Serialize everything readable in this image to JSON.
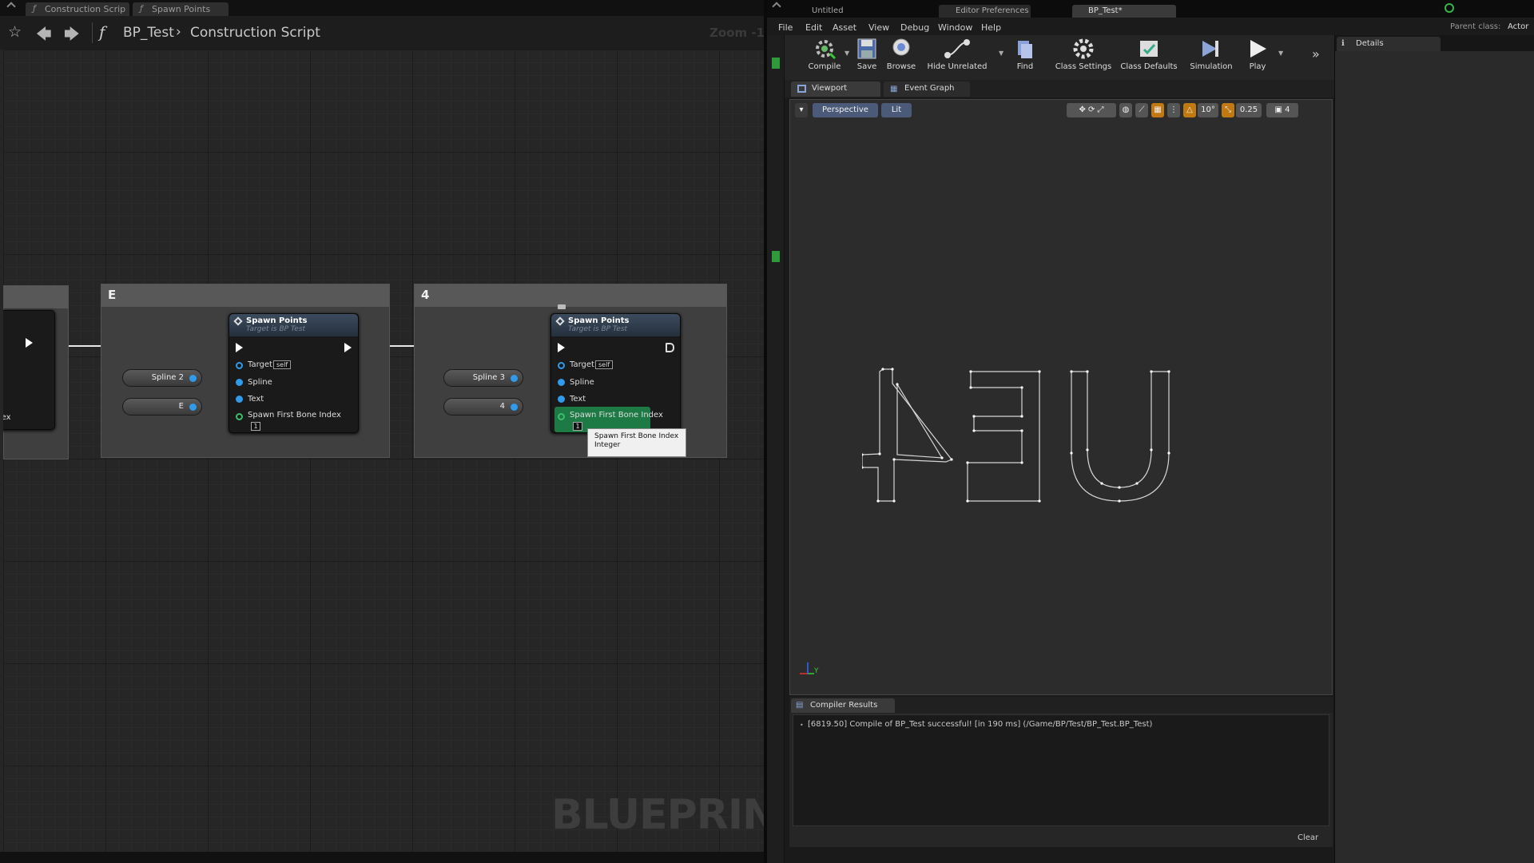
{
  "graph": {
    "tabs": [
      {
        "label": "Construction Scrip"
      },
      {
        "label": "Spawn Points"
      }
    ],
    "breadcrumb": {
      "blueprint": "BP_Test",
      "separator": "›",
      "function": "Construction Script"
    },
    "zoom": "Zoom -1",
    "watermark": "BLUEPRINT",
    "partial_comment": {
      "pin_text": "Index"
    },
    "comments": [
      {
        "header": "E",
        "node": {
          "title": "Spawn Points",
          "subtitle": "Target is BP Test",
          "pins": [
            "Target",
            "Spline",
            "Text",
            "Spawn First Bone Index"
          ],
          "self_label": "self",
          "index_value": "1"
        },
        "vars": [
          "Spline 2",
          "E"
        ]
      },
      {
        "header": "4",
        "node": {
          "title": "Spawn Points",
          "subtitle": "Target is BP Test",
          "pins": [
            "Target",
            "Spline",
            "Text",
            "Spawn First Bone Index"
          ],
          "self_label": "self",
          "index_value": "1"
        },
        "vars": [
          "Spline 3",
          "4"
        ]
      }
    ],
    "tooltip": {
      "line1": "Spawn First Bone Index",
      "line2": "Integer"
    }
  },
  "editor": {
    "top_tabs": [
      {
        "label": "Untitled"
      },
      {
        "label": "Editor Preferences"
      },
      {
        "label": "BP_Test*"
      }
    ],
    "menu": [
      "File",
      "Edit",
      "Asset",
      "View",
      "Debug",
      "Window",
      "Help"
    ],
    "parent_class": {
      "label": "Parent class:",
      "value": "Actor"
    },
    "toolbar": [
      {
        "label": "Compile",
        "icon": "compile-icon"
      },
      {
        "label": "Save",
        "icon": "save-icon"
      },
      {
        "label": "Browse",
        "icon": "browse-icon"
      },
      {
        "label": "Hide Unrelated",
        "icon": "hide-unrelated-icon"
      },
      {
        "label": "Find",
        "icon": "find-icon"
      },
      {
        "label": "Class Settings",
        "icon": "class-settings-icon"
      },
      {
        "label": "Class Defaults",
        "icon": "class-defaults-icon"
      },
      {
        "label": "Simulation",
        "icon": "simulation-icon"
      },
      {
        "label": "Play",
        "icon": "play-icon"
      }
    ],
    "viewport_tabs": [
      {
        "label": "Viewport"
      },
      {
        "label": "Event Graph"
      }
    ],
    "viewport_toolbar": {
      "perspective": "Perspective",
      "lit": "Lit",
      "angle_snap": "10°",
      "scale_snap": "0.25",
      "camera_speed": "4"
    },
    "viewport_text": "4EU",
    "axis_labels": {
      "y": "Y"
    },
    "compiler": {
      "tab": "Compiler Results",
      "message": "[6819.50] Compile of BP_Test successful! [in 190 ms] (/Game/BP/Test/BP_Test.BP_Test)",
      "clear": "Clear"
    },
    "details": {
      "tab": "Details"
    }
  }
}
